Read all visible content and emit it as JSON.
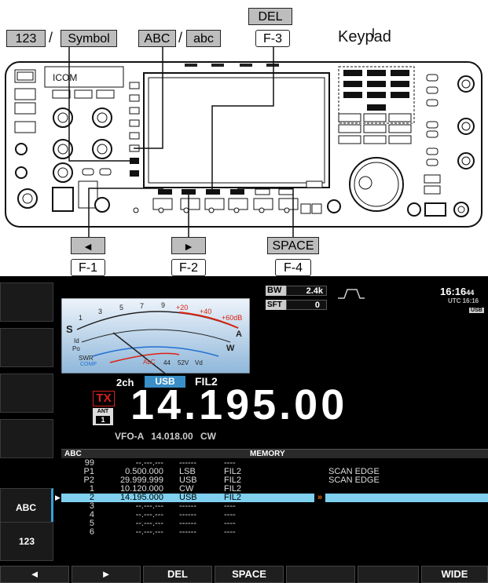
{
  "diagram": {
    "keys": {
      "num": "123",
      "slash1": "/",
      "symbol": "Symbol",
      "upper": "ABC",
      "slash2": "/",
      "lower": "abc",
      "del": "DEL",
      "f3": "F-3",
      "keypad": "Keypad",
      "left_arrow": "◄",
      "f1": "F-1",
      "right_arrow": "►",
      "f2": "F-2",
      "space": "SPACE",
      "f4": "F-4"
    },
    "logo": "ICOM"
  },
  "screen": {
    "bw_label": "BW",
    "bw_value": "2.4k",
    "sft_label": "SFT",
    "sft_value": "0",
    "clock": "16:16",
    "clock_sec": "44",
    "utc": "UTC 16:16",
    "mode_badge": "USB",
    "channel": "2ch",
    "mode": "USB",
    "filter": "FIL2",
    "tx": "TX",
    "ant": "ANT",
    "ant_num": "1",
    "frequency": "14.195.00",
    "vfo_label": "VFO-A",
    "vfo_freq": "14.018.00",
    "vfo_mode": "CW",
    "meter": {
      "s_label": "S",
      "scale_top": [
        "1",
        "3",
        "5",
        "7",
        "9",
        "+20",
        "+40",
        "+60dB"
      ],
      "a_label": "A",
      "w_label": "W",
      "swr": "SWR",
      "comp": "COMP",
      "alc": "ALC",
      "v44": "44",
      "v52": "52V",
      "vd": "Vd",
      "po": "Po",
      "id": "Id"
    },
    "list_header_left": "ABC",
    "list_header_center": "MEMORY",
    "rows": [
      {
        "ch": "99",
        "freq": "--.---.---",
        "mode": "------",
        "fil": "----",
        "name": ""
      },
      {
        "ch": "P1",
        "freq": "0.500.000",
        "mode": "LSB",
        "fil": "FIL2",
        "name": "SCAN  EDGE"
      },
      {
        "ch": "P2",
        "freq": "29.999.999",
        "mode": "USB",
        "fil": "FIL2",
        "name": "SCAN  EDGE"
      },
      {
        "ch": "1",
        "freq": "10.120.000",
        "mode": "CW",
        "fil": "FIL2",
        "name": ""
      },
      {
        "ch": "2",
        "freq": "14.195.000",
        "mode": "USB",
        "fil": "FIL2",
        "name": ""
      },
      {
        "ch": "3",
        "freq": "--.---.---",
        "mode": "------",
        "fil": "----",
        "name": ""
      },
      {
        "ch": "4",
        "freq": "--.---.---",
        "mode": "------",
        "fil": "----",
        "name": ""
      },
      {
        "ch": "5",
        "freq": "--.---.---",
        "mode": "------",
        "fil": "----",
        "name": ""
      },
      {
        "ch": "6",
        "freq": "--.---.---",
        "mode": "------",
        "fil": "----",
        "name": ""
      }
    ],
    "selected_row": 4,
    "side_buttons": [
      "",
      "",
      "",
      "",
      "ABC",
      "123"
    ],
    "bottom_buttons": [
      "◄",
      "►",
      "DEL",
      "SPACE",
      "",
      "",
      "WIDE"
    ],
    "colors": {
      "highlight": "#7fd0ee",
      "accent": "#3aa0d8",
      "tx": "#d62020"
    }
  }
}
